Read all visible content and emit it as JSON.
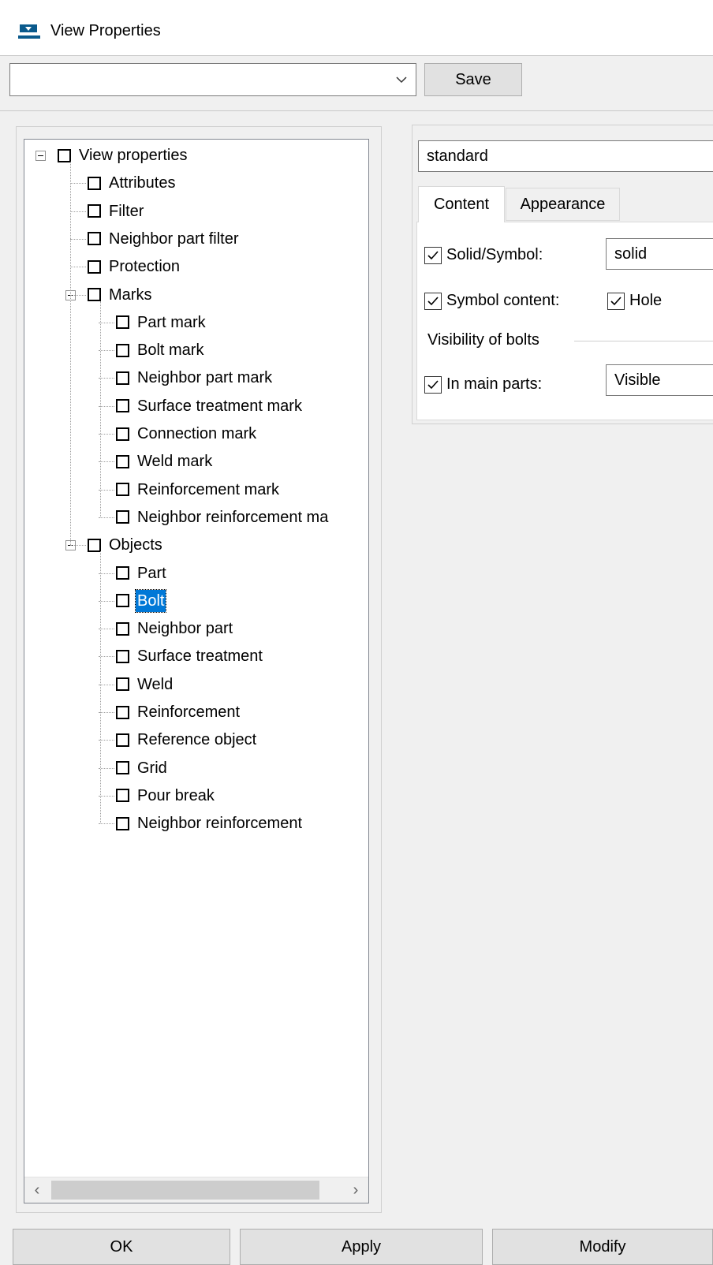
{
  "window": {
    "title": "View Properties",
    "icon": "view-properties-app-icon"
  },
  "toolbar": {
    "preset_value": "",
    "save_label": "Save"
  },
  "tree": {
    "nodes": [
      {
        "label": "View properties",
        "level": 0,
        "expanded": true
      },
      {
        "label": "Attributes",
        "level": 1
      },
      {
        "label": "Filter",
        "level": 1
      },
      {
        "label": "Neighbor part filter",
        "level": 1
      },
      {
        "label": "Protection",
        "level": 1
      },
      {
        "label": "Marks",
        "level": 1,
        "expanded": true
      },
      {
        "label": "Part mark",
        "level": 2
      },
      {
        "label": "Bolt mark",
        "level": 2
      },
      {
        "label": "Neighbor part mark",
        "level": 2
      },
      {
        "label": "Surface treatment mark",
        "level": 2
      },
      {
        "label": "Connection mark",
        "level": 2
      },
      {
        "label": "Weld mark",
        "level": 2
      },
      {
        "label": "Reinforcement mark",
        "level": 2
      },
      {
        "label": "Neighbor reinforcement ma",
        "level": 2
      },
      {
        "label": "Objects",
        "level": 1,
        "expanded": true
      },
      {
        "label": "Part",
        "level": 2
      },
      {
        "label": "Bolt",
        "level": 2,
        "selected": true
      },
      {
        "label": "Neighbor part",
        "level": 2
      },
      {
        "label": "Surface treatment",
        "level": 2
      },
      {
        "label": "Weld",
        "level": 2
      },
      {
        "label": "Reinforcement",
        "level": 2
      },
      {
        "label": "Reference object",
        "level": 2
      },
      {
        "label": "Grid",
        "level": 2
      },
      {
        "label": "Pour break",
        "level": 2
      },
      {
        "label": "Neighbor reinforcement",
        "level": 2
      }
    ]
  },
  "panel": {
    "name_value": "standard",
    "tabs": [
      {
        "label": "Content",
        "active": true
      },
      {
        "label": "Appearance",
        "active": false
      }
    ],
    "solid_symbol": {
      "label": "Solid/Symbol:",
      "checked": true,
      "value": "solid"
    },
    "symbol_content": {
      "label": "Symbol content:",
      "checked": true,
      "hole_label": "Hole",
      "hole_checked": true
    },
    "visibility_group": "Visibility of bolts",
    "in_main_parts": {
      "label": "In main parts:",
      "checked": true,
      "value": "Visible"
    }
  },
  "buttons": {
    "ok": "OK",
    "apply": "Apply",
    "modify": "Modify"
  },
  "colors": {
    "selection": "#0078d7",
    "background": "#f0f0f0"
  }
}
